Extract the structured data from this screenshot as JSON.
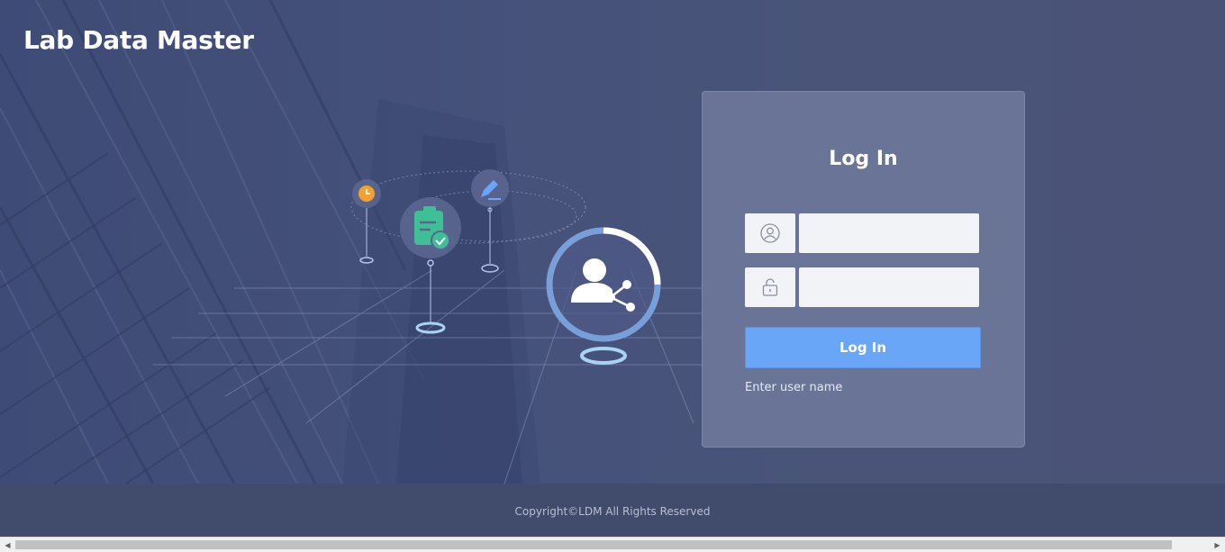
{
  "app": {
    "title": "Lab Data Master"
  },
  "login": {
    "heading": "Log In",
    "username": {
      "value": "",
      "icon": "user-circle-icon"
    },
    "password": {
      "value": "",
      "icon": "lock-icon"
    },
    "button_label": "Log In",
    "hint": "Enter user name"
  },
  "footer": {
    "copyright": "Copyright©LDM All Rights Reserved"
  },
  "colors": {
    "background": "#434f74",
    "panel": "#6a7497",
    "button": "#6aa6f7",
    "footer": "#414b6c"
  }
}
